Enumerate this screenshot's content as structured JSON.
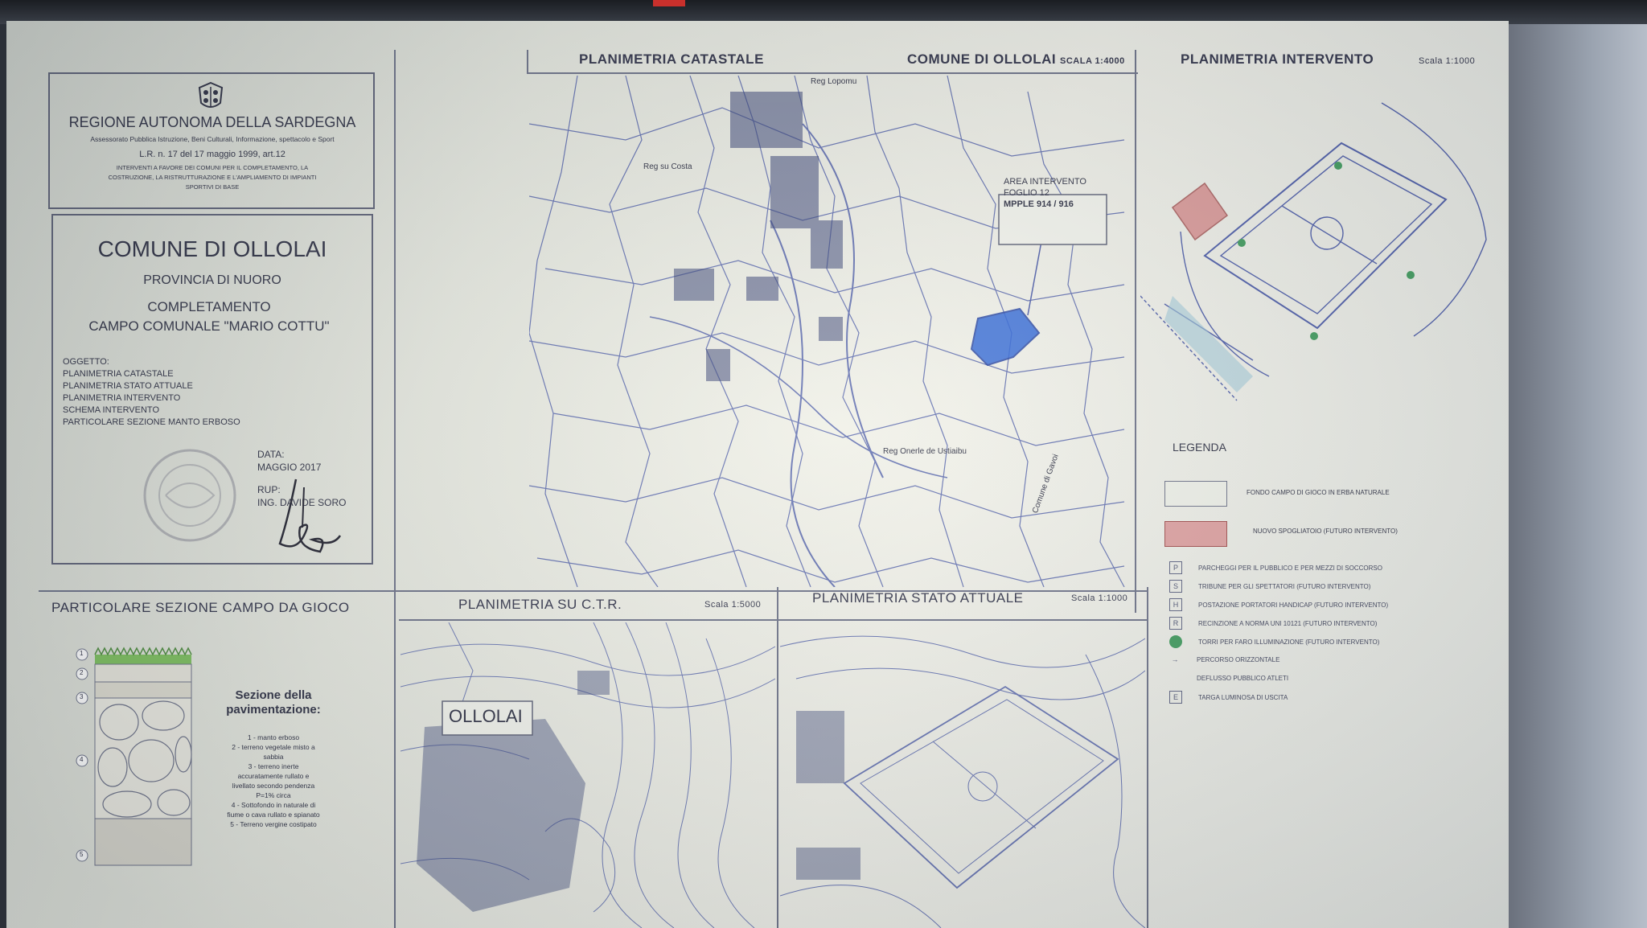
{
  "header": {
    "region": "REGIONE AUTONOMA DELLA SARDEGNA",
    "assessorato": "Assessorato Pubblica Istruzione, Beni Culturali, Informazione, spettacolo e Sport",
    "law": "L.R. n. 17 del 17 maggio 1999, art.12",
    "interventi_1": "INTERVENTI A FAVORE DEI COMUNI PER IL COMPLETAMENTO, LA",
    "interventi_2": "COSTRUZIONE, LA RISTRUTTURAZIONE E L'AMPLIAMENTO DI IMPIANTI",
    "interventi_3": "SPORTIVI DI BASE"
  },
  "project": {
    "comune": "COMUNE DI OLLOLAI",
    "provincia": "PROVINCIA DI NUORO",
    "title_1": "COMPLETAMENTO",
    "title_2": "CAMPO COMUNALE \"MARIO COTTU\"",
    "oggetto_label": "OGGETTO:",
    "oggetto": [
      "PLANIMETRIA CATASTALE",
      "PLANIMETRIA STATO ATTUALE",
      "PLANIMETRIA INTERVENTO",
      "SCHEMA INTERVENTO",
      "PARTICOLARE SEZIONE MANTO ERBOSO"
    ],
    "data_label": "DATA:",
    "data": "MAGGIO 2017",
    "rup_label": "RUP:",
    "rup": "ING. DAVIDE SORO"
  },
  "panels": {
    "catastale": "PLANIMETRIA CATASTALE",
    "comune_scale": "COMUNE DI OLLOLAI",
    "catastale_scale": "SCALA 1:4000",
    "intervento": "PLANIMETRIA INTERVENTO",
    "intervento_scale": "Scala 1:1000",
    "sezione": "PARTICOLARE SEZIONE CAMPO DA GIOCO",
    "ctr": "PLANIMETRIA SU C.T.R.",
    "ctr_scale": "Scala 1:5000",
    "stato": "PLANIMETRIA STATO ATTUALE",
    "stato_scale": "Scala 1:1000"
  },
  "map": {
    "area_1": "AREA INTERVENTO",
    "area_2": "FOGLIO 12",
    "area_3": "MPPLE 914 / 916",
    "reg_costa": "Reg su Costa",
    "reg_onerle": "Reg Onerle de Ustiaibu",
    "comune_gavoi": "Comune di Gavoi",
    "reg_top": "Reg Lopomu",
    "ollolai": "OLLOLAI"
  },
  "sezione": {
    "title_1": "Sezione della",
    "title_2": "pavimentazione:",
    "layers": [
      "1 - manto erboso",
      "2 - terreno vegetale misto a",
      "sabbia",
      "3 - terreno inerte",
      "accuratamente rullato e",
      "livellato secondo pendenza",
      "P=1% circa",
      "4 - Sottofondo in naturale di",
      "fiume o cava rullato e spianato",
      "5 - Terreno vergine costipato"
    ],
    "markers": [
      "1",
      "2",
      "3",
      "4",
      "5"
    ]
  },
  "legenda": {
    "title": "LEGENDA",
    "items": [
      "FONDO CAMPO DI GIOCO IN ERBA NATURALE",
      "NUOVO SPOGLIATOIO (FUTURO INTERVENTO)",
      "PARCHEGGI PER IL PUBBLICO E PER MEZZI DI SOCCORSO",
      "TRIBUNE PER GLI SPETTATORI (FUTURO INTERVENTO)",
      "POSTAZIONE PORTATORI HANDICAP (FUTURO INTERVENTO)",
      "RECINZIONE A NORMA UNI 10121 (FUTURO INTERVENTO)",
      "TORRI PER FARO ILLUMINAZIONE (FUTURO INTERVENTO)",
      "PERCORSO ORIZZONTALE",
      "DEFLUSSO PUBBLICO ATLETI",
      "TARGA LUMINOSA DI USCITA"
    ],
    "symbols": [
      "P",
      "S",
      "H",
      "R",
      "",
      "",
      "",
      "E"
    ]
  },
  "colors": {
    "ink": "#2a2c40",
    "map_line": "#4a5aa8",
    "area_fill": "#2a63d8",
    "spogliatoio": "#d98a8a",
    "green": "#3c9a5a"
  }
}
